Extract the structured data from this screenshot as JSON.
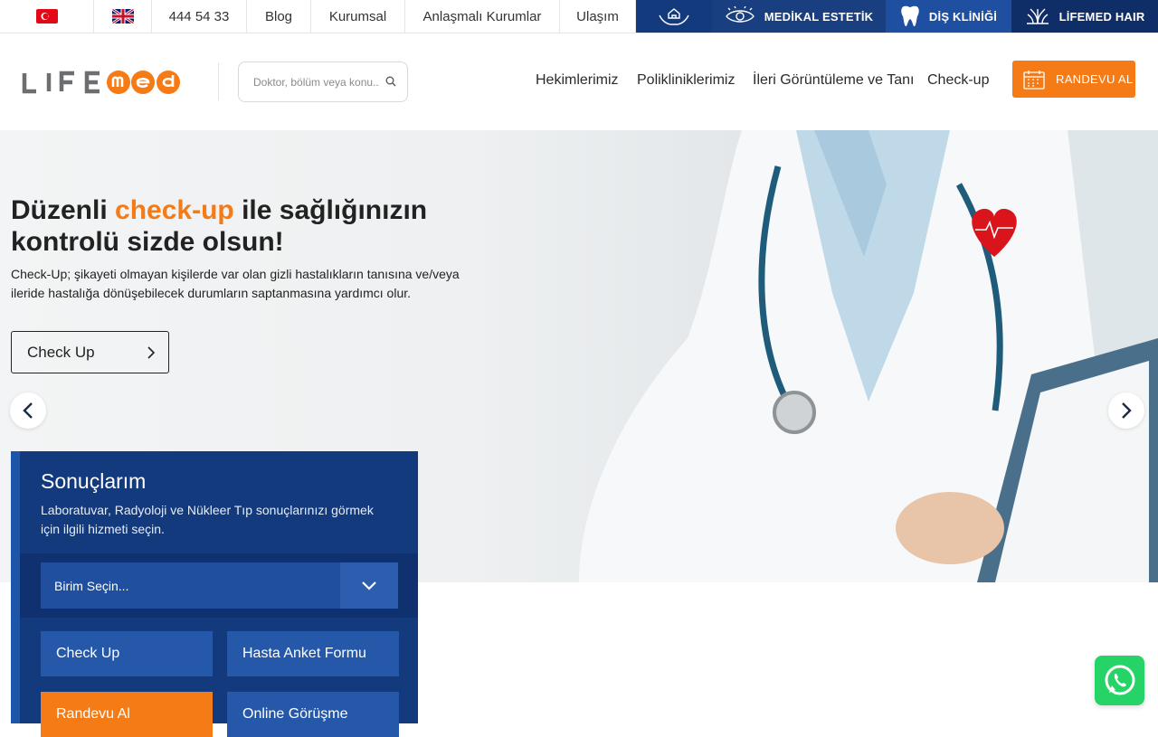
{
  "topbar": {
    "phone": "444 54 33",
    "links": [
      "Blog",
      "Kurumsal",
      "Anlaşmalı Kurumlar",
      "Ulaşım"
    ],
    "services": [
      {
        "label": "",
        "icon": "hands-house-icon",
        "color": "#123a7d"
      },
      {
        "label": "MEDİKAL ESTETİK",
        "icon": "eye-icon",
        "color": "#1a3f80"
      },
      {
        "label": "DİŞ KLİNİĞİ",
        "icon": "tooth-icon",
        "color": "#1f4fa0"
      },
      {
        "label": "LİFEMED HAIR",
        "icon": "hair-icon",
        "color": "#0f2d66"
      }
    ]
  },
  "header": {
    "logo_text": "LIFEmed",
    "search_placeholder": "Doktor, bölüm veya konu...",
    "nav": [
      "Hekimlerimiz",
      "Polikliniklerimiz",
      "İleri Görüntüleme ve Tanı",
      "Check-up"
    ],
    "appointment_label": "RANDEVU AL"
  },
  "hero": {
    "title_part1": "Düzenli ",
    "title_accent": "check-up",
    "title_part2": " ile sağlığınızın kontrolü sizde olsun!",
    "description": "Check-Up; şikayeti olmayan kişilerde var olan gizli hastalıkların tanısına ve/veya ileride hastalığa dönüşebilecek durumların saptanmasına yardımcı olur.",
    "button_label": "Check Up"
  },
  "results": {
    "title": "Sonuçlarım",
    "description": "Laboratuvar, Radyoloji ve Nükleer Tıp sonuçlarınızı görmek için ilgili hizmeti seçin.",
    "select_value": "Birim Seçin...",
    "buttons": [
      "Check Up",
      "Hasta Anket Formu",
      "Randevu Al",
      "Online Görüşme"
    ]
  },
  "colors": {
    "accent": "#f47b16",
    "navy": "#123a7d",
    "whatsapp": "#25d366"
  }
}
